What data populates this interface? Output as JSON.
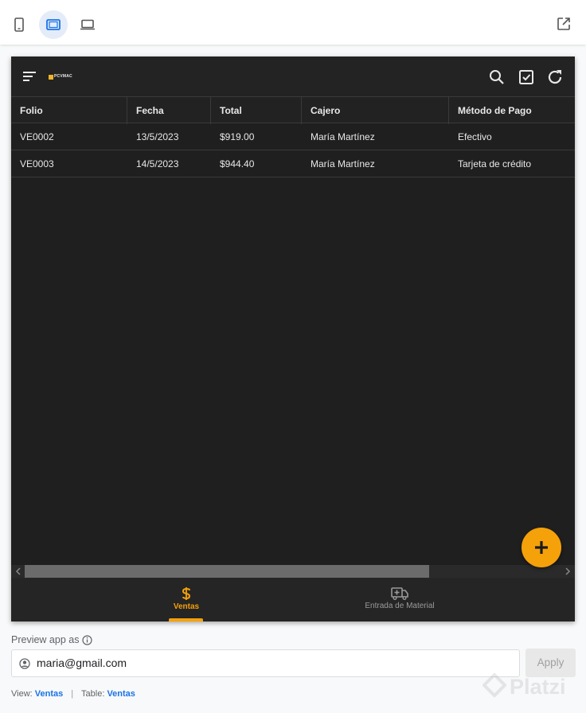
{
  "preview": {
    "header": {},
    "table": {
      "columns": [
        "Folio",
        "Fecha",
        "Total",
        "Cajero",
        "Método de Pago"
      ],
      "rows": [
        [
          "VE0002",
          "13/5/2023",
          "$919.00",
          "María Martínez",
          "Efectivo"
        ],
        [
          "VE0003",
          "14/5/2023",
          "$944.40",
          "María Martínez",
          "Tarjeta de crédito"
        ]
      ]
    },
    "bottom_nav": [
      {
        "label": "Ventas",
        "icon": "dollar-icon",
        "active": true
      },
      {
        "label": "Entrada de Material",
        "icon": "ambulance-icon",
        "active": false
      }
    ],
    "fab_icon": "plus-icon"
  },
  "preview_as": {
    "label": "Preview app as",
    "email_value": "maria@gmail.com",
    "apply_label": "Apply"
  },
  "meta": {
    "view_label": "View:",
    "view_value": "Ventas",
    "separator": "|",
    "table_label": "Table:",
    "table_value": "Ventas"
  },
  "logo_text": "PCVMAC",
  "watermark": "Platzi",
  "colors": {
    "accent": "#f5a10a",
    "link": "#1a73e8",
    "app_background": "#1f1f1f"
  }
}
